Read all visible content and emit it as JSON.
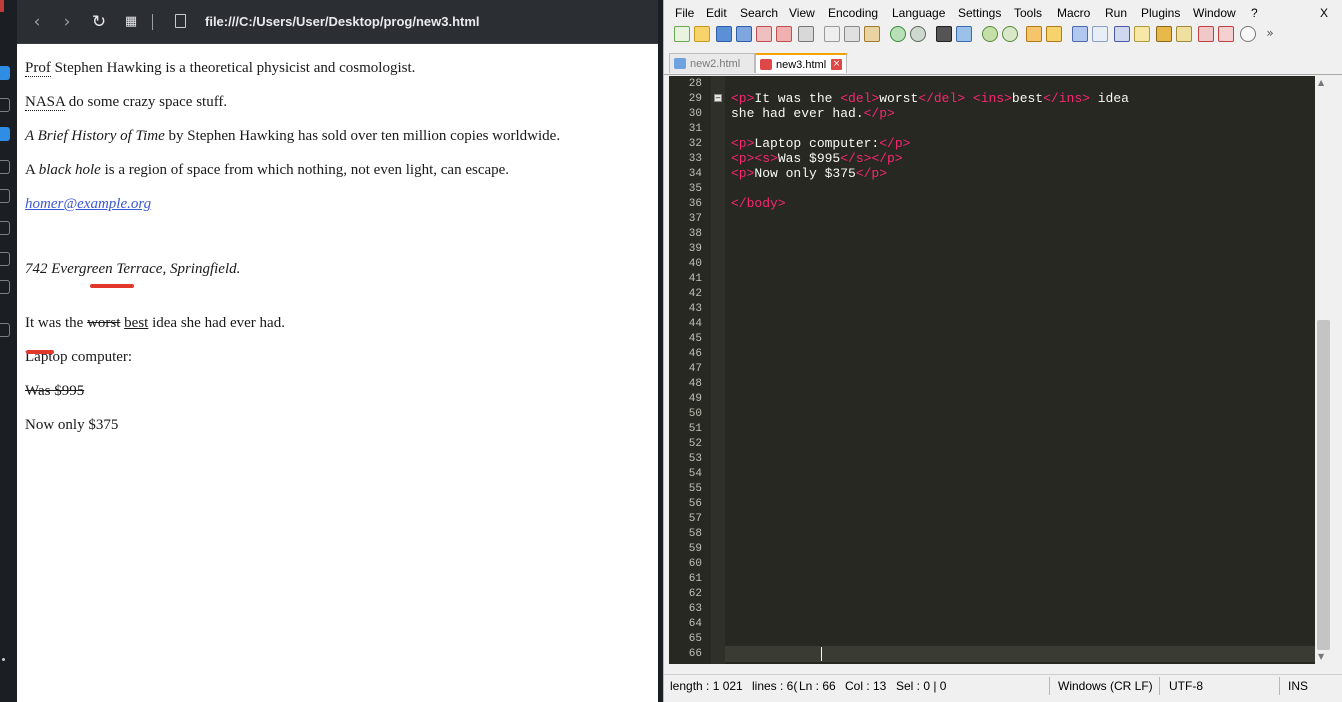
{
  "browser": {
    "url": "file:///C:/Users/User/Desktop/prog/new3.html",
    "icons": [
      "back-icon",
      "forward-icon",
      "reload-icon",
      "tabs-grid-icon",
      "page-icon"
    ]
  },
  "page": {
    "p1_abbr": "Prof",
    "p1_rest": " Stephen Hawking is a theoretical physicist and cosmologist.",
    "p2_abbr": "NASA",
    "p2_rest": " do some crazy space stuff.",
    "p3_title": "A Brief History of Time",
    "p3_rest": " by Stephen Hawking has sold over ten million copies worldwide.",
    "p4_pre": "A ",
    "p4_em": "black hole",
    "p4_rest": " is a region of space from which nothing, not even light, can escape.",
    "email": "homer@example.org",
    "address": "742 Evergreen Terrace, Springfield.",
    "p7_pre": "It was the ",
    "p7_del": "worst",
    "p7_ins": "best",
    "p7_rest": " idea she had ever had.",
    "laptop": "Laptop computer:",
    "was_price": "Was $995",
    "now_price": "Now only $375"
  },
  "editor": {
    "menu": [
      "File",
      "Edit",
      "Search",
      "View",
      "Encoding",
      "Language",
      "Settings",
      "Tools",
      "Macro",
      "Run",
      "Plugins",
      "Window",
      "?",
      "X"
    ],
    "tabs": [
      {
        "label": "new2.html",
        "active": false
      },
      {
        "label": "new3.html",
        "active": true
      }
    ],
    "line_numbers": [
      "28",
      "29",
      "30",
      "31",
      "32",
      "33",
      "34",
      "35",
      "36",
      "37",
      "38",
      "39",
      "40",
      "41",
      "42",
      "43",
      "44",
      "45",
      "46",
      "47",
      "48",
      "49",
      "50",
      "51",
      "52",
      "53",
      "54",
      "55",
      "56",
      "57",
      "58",
      "59",
      "60",
      "61",
      "62",
      "63",
      "64",
      "65",
      "66"
    ],
    "code": {
      "l29_a": "<p>",
      "l29_b": "It was the ",
      "l29_c": "<del>",
      "l29_d": "worst",
      "l29_e": "</del>",
      "l29_f": " ",
      "l29_g": "<ins>",
      "l29_h": "best",
      "l29_i": "</ins>",
      "l29_j": " idea",
      "l30_a": "she had ever had.",
      "l30_b": "</p>",
      "l32_a": "<p>",
      "l32_b": "Laptop computer:",
      "l32_c": "</p>",
      "l33_a": "<p><s>",
      "l33_b": "Was $995",
      "l33_c": "</s></p>",
      "l34_a": "<p>",
      "l34_b": "Now only $375",
      "l34_c": "</p>",
      "l36_a": "</body>"
    },
    "status": {
      "length": "length : 1 021",
      "lines": "lines : 6(",
      "ln": "Ln : 66",
      "col": "Col : 13",
      "sel": "Sel : 0 | 0",
      "eol": "Windows (CR LF)",
      "encoding": "UTF-8",
      "mode": "INS"
    }
  },
  "colors": {
    "tag": "#f92672",
    "editor_bg": "#272822",
    "annotation_red": "#e2372b"
  }
}
